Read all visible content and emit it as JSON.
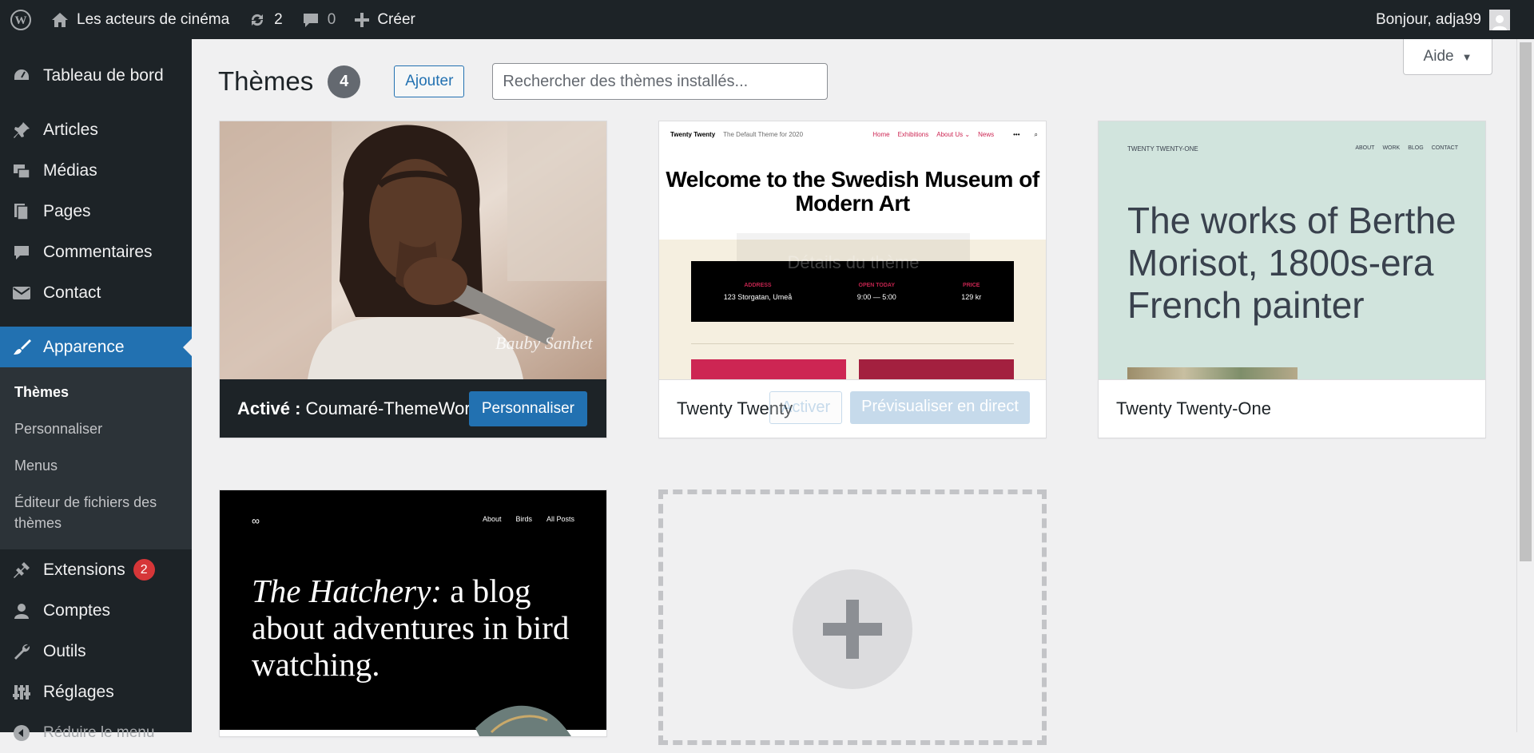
{
  "adminbar": {
    "site_name": "Les acteurs de cinéma",
    "updates_count": "2",
    "comments_count": "0",
    "create_label": "Créer",
    "greeting": "Bonjour, adja99"
  },
  "sidebar": {
    "items": [
      {
        "label": "Tableau de bord",
        "icon": "dashboard-icon"
      },
      {
        "label": "Articles",
        "icon": "pin-icon"
      },
      {
        "label": "Médias",
        "icon": "media-icon"
      },
      {
        "label": "Pages",
        "icon": "pages-icon"
      },
      {
        "label": "Commentaires",
        "icon": "comment-icon"
      },
      {
        "label": "Contact",
        "icon": "mail-icon"
      },
      {
        "label": "Apparence",
        "icon": "brush-icon"
      }
    ],
    "submenu": [
      "Thèmes",
      "Personnaliser",
      "Menus",
      "Éditeur de fichiers des thèmes"
    ],
    "items2": [
      {
        "label": "Extensions",
        "icon": "plugin-icon",
        "badge": "2"
      },
      {
        "label": "Comptes",
        "icon": "user-icon"
      },
      {
        "label": "Outils",
        "icon": "wrench-icon"
      },
      {
        "label": "Réglages",
        "icon": "settings-icon"
      },
      {
        "label": "Réduire le menu",
        "icon": "collapse-icon"
      }
    ]
  },
  "main": {
    "help_label": "Aide",
    "title": "Thèmes",
    "count": "4",
    "add_label": "Ajouter",
    "search_placeholder": "Rechercher des thèmes installés..."
  },
  "themes": {
    "active": {
      "prefix": "Activé :",
      "name": "Coumaré-ThemeWor...",
      "customize": "Personnaliser"
    },
    "twenty_twenty": {
      "name": "Twenty Twenty",
      "details": "Détails du thème",
      "activate": "Activer",
      "preview": "Prévisualiser en direct",
      "shot": {
        "brand": "Twenty Twenty",
        "tagline": "The Default Theme for 2020",
        "nav": [
          "Home",
          "Exhibitions",
          "About Us ⌄",
          "News"
        ],
        "hero": "Welcome to the Swedish Museum of Modern Art",
        "info": [
          {
            "k": "ADDRESS",
            "v": "123 Storgatan, Umeå"
          },
          {
            "k": "OPEN TODAY",
            "v": "9:00 — 5:00"
          },
          {
            "k": "PRICE",
            "v": "129 kr"
          }
        ]
      }
    },
    "twenty_twenty_one": {
      "name": "Twenty Twenty-One",
      "shot": {
        "brand": "TWENTY TWENTY-ONE",
        "nav": [
          "ABOUT",
          "WORK",
          "BLOG",
          "CONTACT"
        ],
        "hero": "The works of Berthe Morisot, 1800s-era French painter"
      }
    },
    "hatchery": {
      "nav": [
        "About",
        "Birds",
        "All Posts"
      ],
      "hero_italic": "The Hatchery:",
      "hero_rest": " a blog about adventures in bird watching."
    }
  },
  "colors": {
    "accent": "#2271b1",
    "adminbar": "#1d2327",
    "badge": "#d63638"
  }
}
